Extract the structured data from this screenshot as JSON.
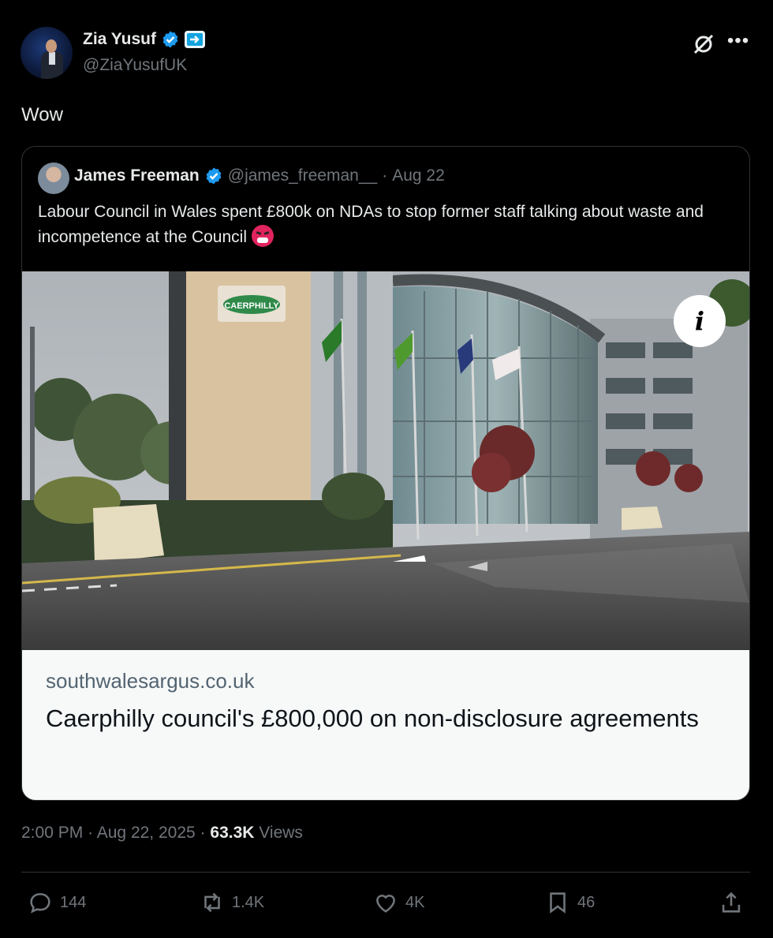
{
  "author": {
    "name": "Zia Yusuf",
    "handle": "@ZiaYusufUK"
  },
  "tweet_text": "Wow",
  "quoted": {
    "name": "James Freeman",
    "handle": "@james_freeman__",
    "separator": "·",
    "date": "Aug 22",
    "text": "Labour Council in Wales spent £800k on NDAs to stop former staff talking about waste and incompetence at the Council",
    "link_card": {
      "domain": "southwalesargus.co.uk",
      "title": "Caerphilly council's £800,000 on non-disclosure agreements",
      "sign_text": "CAERPHILLY"
    }
  },
  "meta": {
    "time": "2:00 PM",
    "date": "Aug 22, 2025",
    "views_count": "63.3K",
    "views_label": "Views",
    "sep": "·"
  },
  "actions": {
    "replies": "144",
    "reposts": "1.4K",
    "likes": "4K",
    "bookmarks": "46"
  },
  "colors": {
    "background": "#000000",
    "text": "#e7e9ea",
    "muted": "#71767b",
    "verified": "#1d9bf0",
    "border": "#2f3336"
  }
}
